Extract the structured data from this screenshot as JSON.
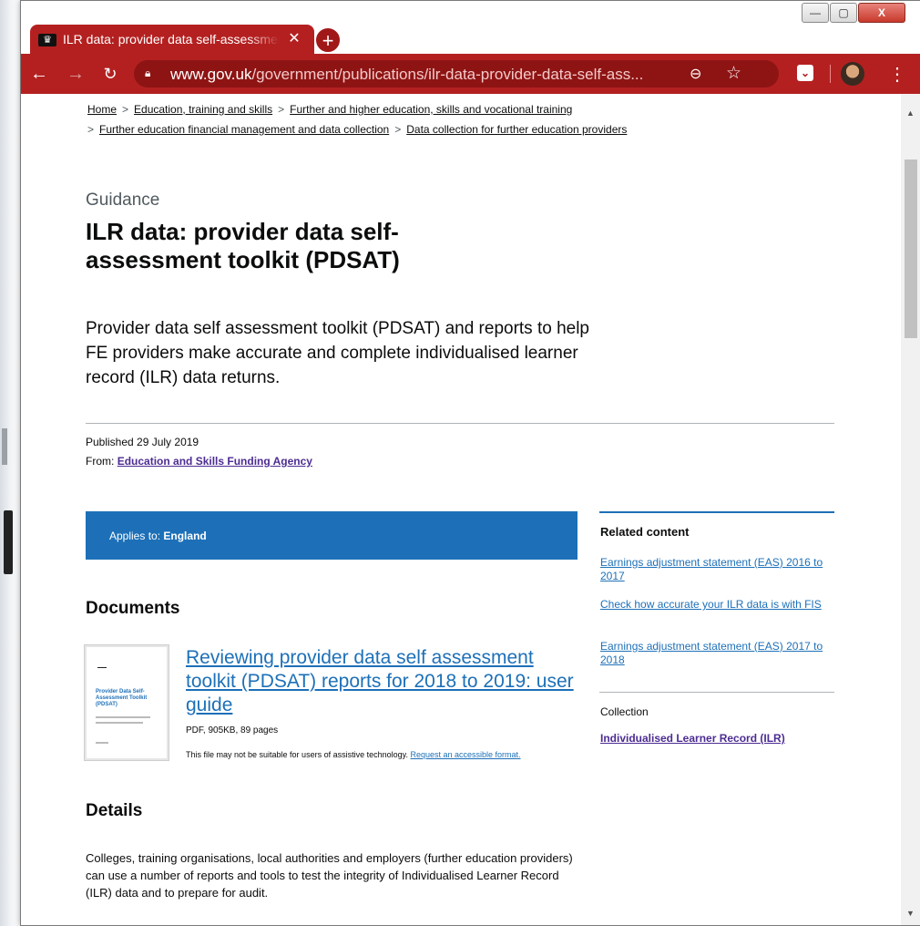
{
  "browser": {
    "tab_title": "ILR data: provider data self-assessment toolkit (PDSAT) - GOV.UK",
    "tab_close": "✕",
    "new_tab": "+",
    "url_host": "www.gov.uk",
    "url_path": "/government/publications/ilr-data-provider-data-self-ass...",
    "window_controls": {
      "minimize": "—",
      "maximize": "▢",
      "close": "X"
    },
    "icons": {
      "back": "arrow-left-icon",
      "forward": "arrow-right-icon",
      "reload": "reload-icon",
      "lock": "lock-icon",
      "zoom": "zoom-icon",
      "star": "star-icon",
      "pocket": "pocket-icon",
      "menu": "kebab-menu-icon"
    },
    "accent_color": "#b42020"
  },
  "breadcrumbs": {
    "row1": [
      "Home",
      "Education, training and skills",
      "Further and higher education, skills and vocational training"
    ],
    "row2": [
      "Further education financial management and data collection",
      "Data collection for further education providers"
    ],
    "separator": ">"
  },
  "page": {
    "guidance_label": "Guidance",
    "title": "ILR data: provider data self-assessment toolkit (PDSAT)",
    "summary": "Provider data self assessment toolkit (PDSAT) and reports to help FE providers make accurate and complete individualised learner record (ILR) data returns.",
    "published": "Published 29 July 2019",
    "from_label": "From:",
    "from_link": "Education and Skills Funding Agency",
    "applies_label": "Applies to:",
    "applies_value": "England",
    "documents_heading": "Documents",
    "document": {
      "title": "Reviewing provider data self assessment toolkit (PDSAT) reports for 2018 to 2019: user guide",
      "meta": "PDF, 905KB, 89 pages",
      "note": "This file may not be suitable for users of assistive technology.",
      "note_link": "Request an accessible format.",
      "thumb_title": "Provider Data Self-Assessment Toolkit (PDSAT)"
    },
    "details_heading": "Details",
    "details_text": "Colleges, training organisations, local authorities and employers (further education providers) can use a number of reports and tools to test the integrity of Individualised Learner Record (ILR) data and to prepare for audit."
  },
  "related": {
    "heading": "Related content",
    "links": [
      "Earnings adjustment statement (EAS) 2016 to 2017",
      "Check how accurate your ILR data is with FIS",
      "Earnings adjustment statement (EAS) 2017 to 2018"
    ],
    "collection_label": "Collection",
    "collection_link": "Individualised Learner Record (ILR)"
  },
  "colors": {
    "link": "#1d70b8",
    "visited": "#4c2c92",
    "text": "#0b0c0c",
    "applies_bg": "#1d70b8"
  }
}
